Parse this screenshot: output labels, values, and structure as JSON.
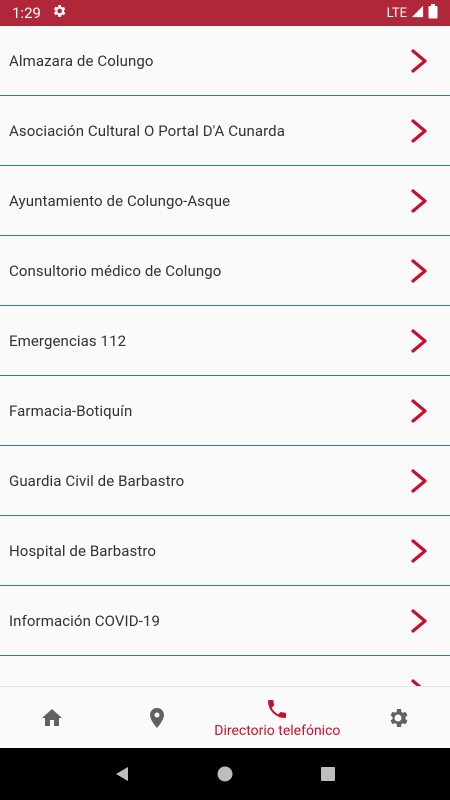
{
  "status_bar": {
    "time": "1:29",
    "network": "LTE"
  },
  "list": {
    "items": [
      {
        "label": "Almazara de Colungo"
      },
      {
        "label": "Asociación Cultural O Portal D'A Cunarda"
      },
      {
        "label": "Ayuntamiento de Colungo-Asque"
      },
      {
        "label": "Consultorio médico de Colungo"
      },
      {
        "label": "Emergencias 112"
      },
      {
        "label": "Farmacia-Botiquín"
      },
      {
        "label": "Guardia Civil de Barbastro"
      },
      {
        "label": "Hospital de Barbastro"
      },
      {
        "label": "Información COVID-19"
      },
      {
        "label": ""
      }
    ]
  },
  "bottom_nav": {
    "active_label": "Directorio telefónico"
  },
  "colors": {
    "accent": "#c8102e",
    "status_bar": "#b0273a",
    "divider": "#2f78b0",
    "icon_gray": "#616161"
  }
}
